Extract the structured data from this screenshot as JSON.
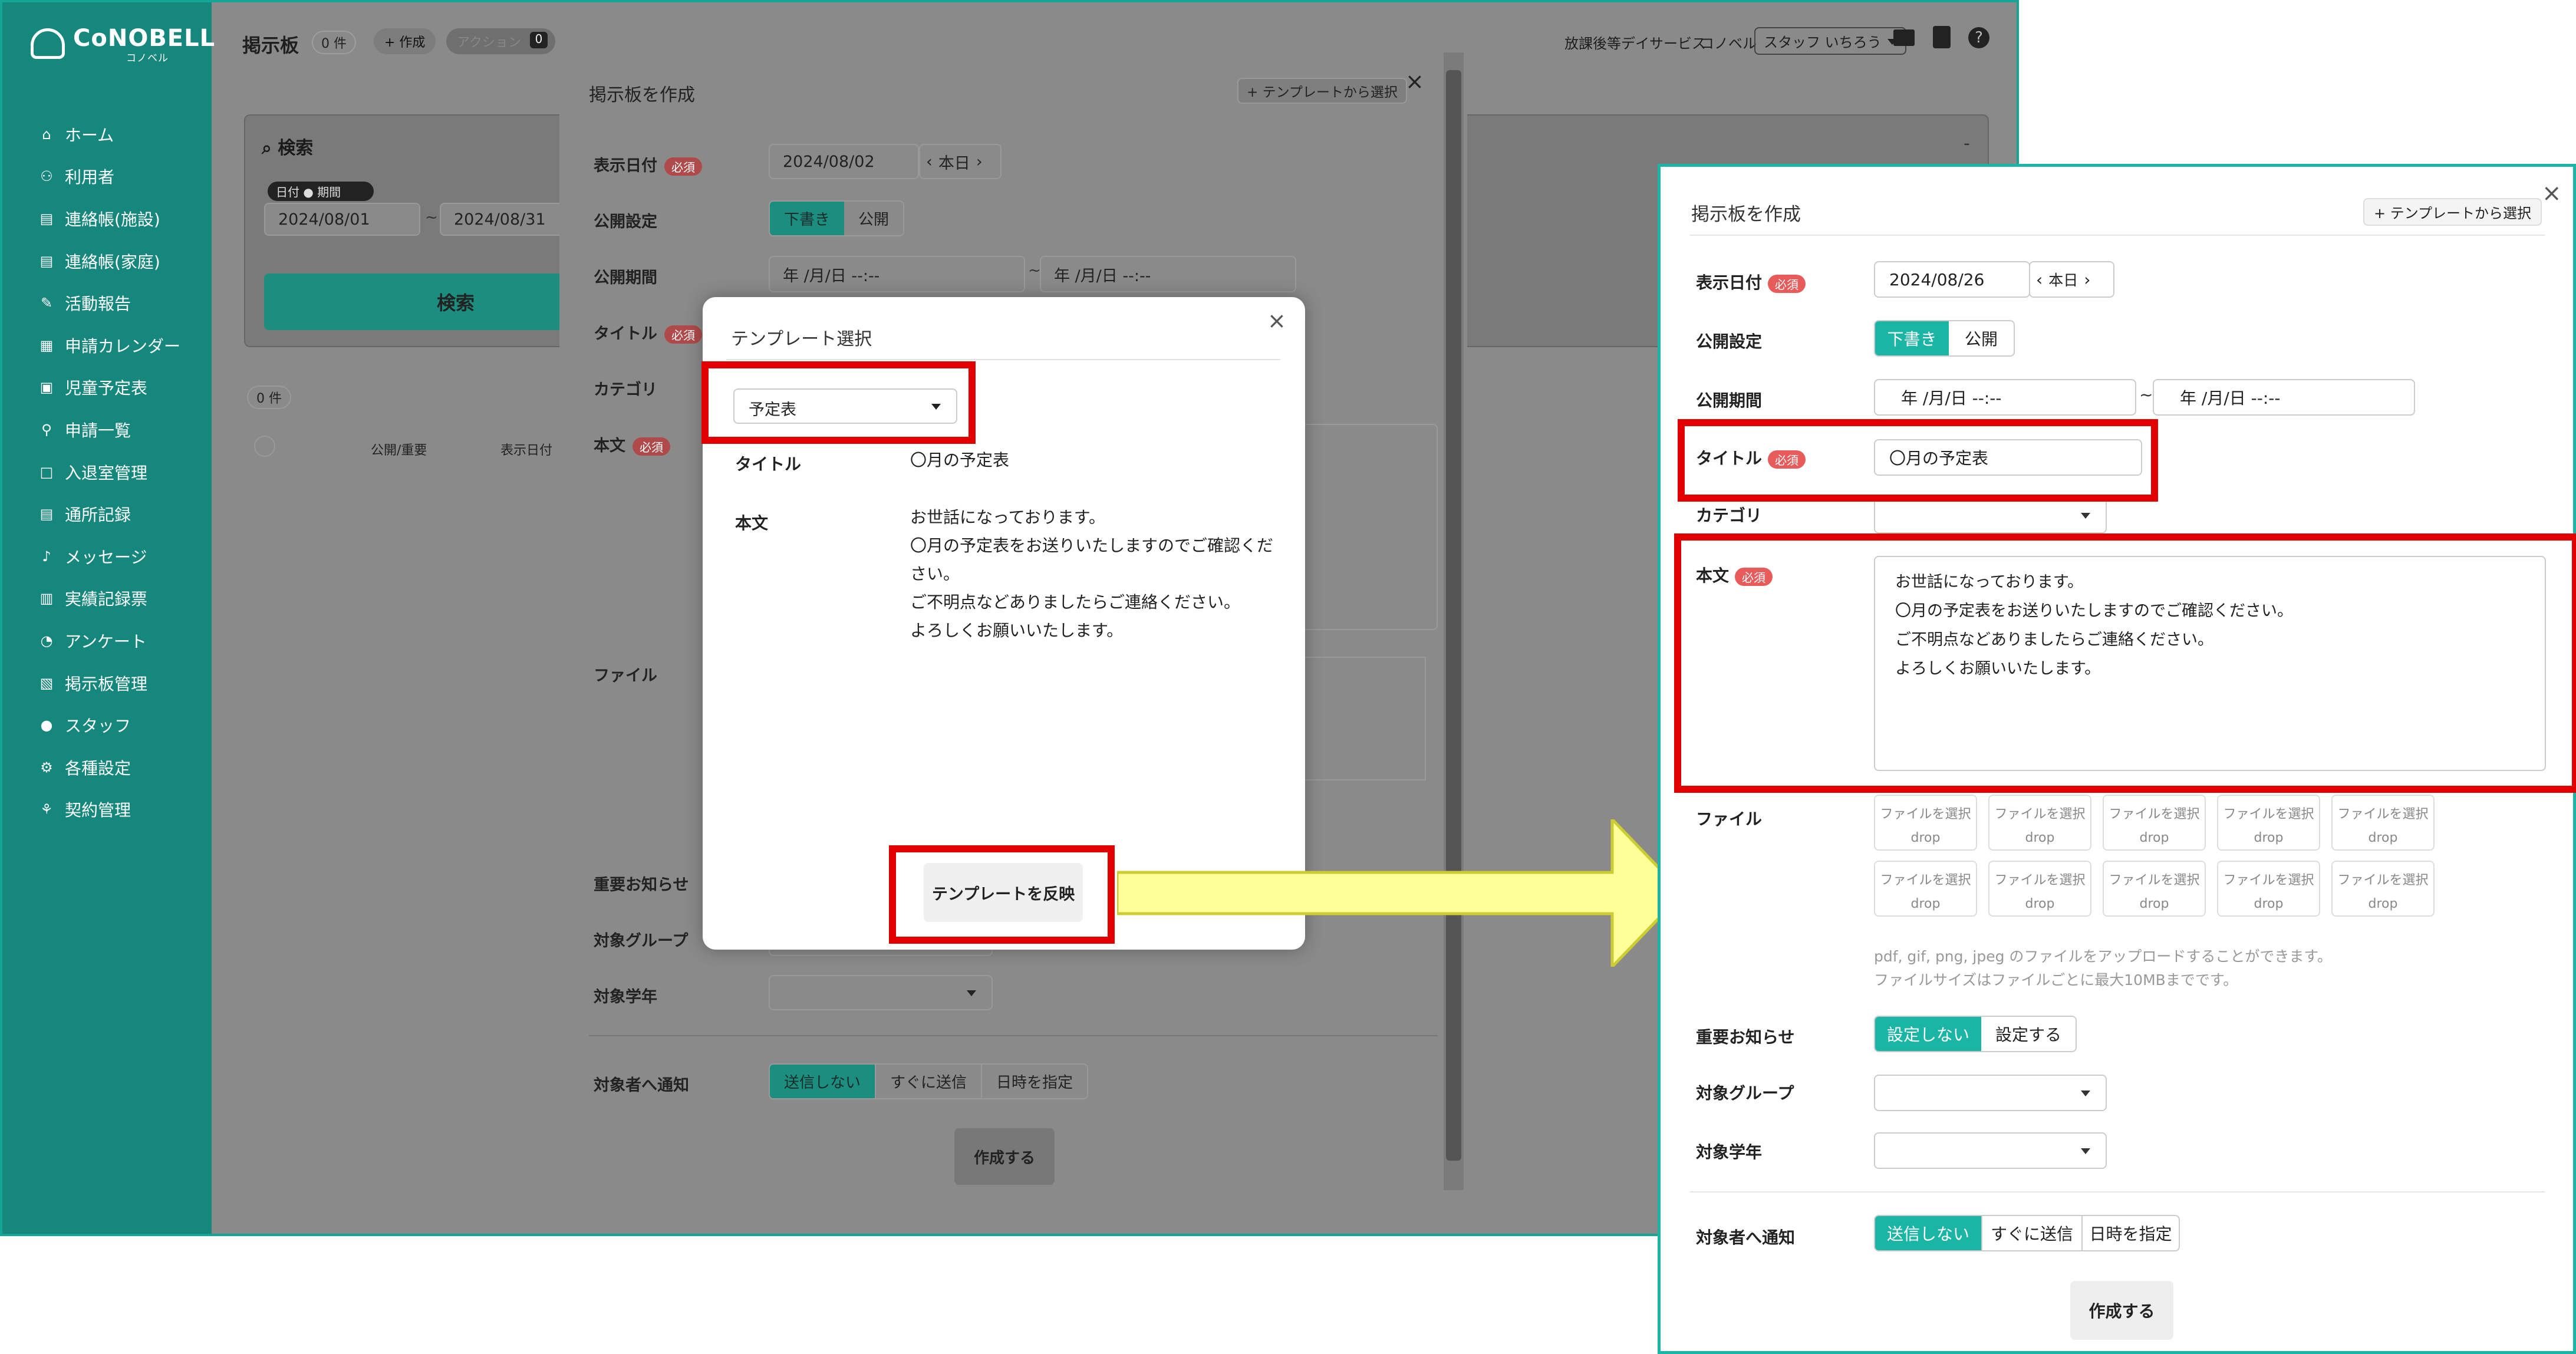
{
  "brand": {
    "name": "CoNOBELL",
    "sub": "コノベル"
  },
  "sidebar": {
    "items": [
      {
        "label": "ホーム",
        "icon": "home-icon"
      },
      {
        "label": "利用者",
        "icon": "users-icon"
      },
      {
        "label": "連絡帳(施設)",
        "icon": "notebook-icon"
      },
      {
        "label": "連絡帳(家庭)",
        "icon": "notebook-icon"
      },
      {
        "label": "活動報告",
        "icon": "edit-icon"
      },
      {
        "label": "申請カレンダー",
        "icon": "calendar-icon"
      },
      {
        "label": "児童予定表",
        "icon": "bus-icon"
      },
      {
        "label": "申請一覧",
        "icon": "filter-icon"
      },
      {
        "label": "入退室管理",
        "icon": "door-icon"
      },
      {
        "label": "通所記録",
        "icon": "book-icon"
      },
      {
        "label": "メッセージ",
        "icon": "bell-icon"
      },
      {
        "label": "実績記録票",
        "icon": "table-icon"
      },
      {
        "label": "アンケート",
        "icon": "chart-icon"
      },
      {
        "label": "掲示板管理",
        "icon": "board-icon"
      },
      {
        "label": "スタッフ",
        "icon": "person-icon"
      },
      {
        "label": "各種設定",
        "icon": "gear-icon"
      },
      {
        "label": "契約管理",
        "icon": "contract-icon"
      }
    ]
  },
  "topbar": {
    "title": "掲示板",
    "count": "0 件",
    "create": "+ 作成",
    "action": "アクション",
    "action_count": "0",
    "service": "放課後等デイサービス",
    "org": "コノベル",
    "user": "スタッフ いちろう"
  },
  "search": {
    "title": "検索",
    "toggle_left": "日付",
    "toggle_right": "期間",
    "date_from": "2024/08/01",
    "date_to": "2024/08/31",
    "button": "検索",
    "result_count": "0 件",
    "col_public": "公開/重要",
    "col_date": "表示日付"
  },
  "bg_modal": {
    "title": "掲示板を作成",
    "template_button": "+ テンプレートから選択",
    "display_date_label": "表示日付",
    "required": "必須",
    "display_date": "2024/08/02",
    "today": "本日",
    "publish_label": "公開設定",
    "draft": "下書き",
    "public": "公開",
    "period_label": "公開期間",
    "period_placeholder": "年 /月/日 --:--",
    "title_label": "タイトル",
    "category_label": "カテゴリ",
    "body_label": "本文",
    "file_label": "ファイル",
    "important_label": "重要お知らせ",
    "group_label": "対象グループ",
    "grade_label": "対象学年",
    "notify_label": "対象者へ通知",
    "notify_options": [
      "送信しない",
      "すぐに送信",
      "日時を指定"
    ],
    "submit": "作成する"
  },
  "template_modal": {
    "title": "テンプレート選択",
    "selected": "予定表",
    "title_label": "タイトル",
    "title_value": "〇月の予定表",
    "body_label": "本文",
    "body_value": "お世話になっております。\n〇月の予定表をお送りいたしますのでご確認ください。\nご不明点などありましたらご連絡ください。\nよろしくお願いいたします。",
    "apply_button": "テンプレートを反映"
  },
  "right_form": {
    "title": "掲示板を作成",
    "template_button": "+ テンプレートから選択",
    "display_date_label": "表示日付",
    "required": "必須",
    "display_date": "2024/08/26",
    "today": "本日",
    "publish_label": "公開設定",
    "draft": "下書き",
    "public": "公開",
    "period_label": "公開期間",
    "period_placeholder": "年 /月/日 --:--",
    "title_label": "タイトル",
    "title_value": "〇月の予定表",
    "category_label": "カテゴリ",
    "body_label": "本文",
    "body_value": "お世話になっております。\n〇月の予定表をお送りいたしますのでご確認ください。\nご不明点などありましたらご連絡ください。\nよろしくお願いいたします。",
    "file_label": "ファイル",
    "file_select": "ファイルを選択",
    "file_drop": "drop",
    "file_note1": "pdf, gif, png, jpeg のファイルをアップロードすることができます。",
    "file_note2": "ファイルサイズはファイルごとに最大10MBまでです。",
    "important_label": "重要お知らせ",
    "important_options": [
      "設定しない",
      "設定する"
    ],
    "group_label": "対象グループ",
    "grade_label": "対象学年",
    "notify_label": "対象者へ通知",
    "notify_options": [
      "送信しない",
      "すぐに送信",
      "日時を指定"
    ],
    "submit": "作成する"
  },
  "colors": {
    "teal": "#1ab5a4",
    "highlight": "#e10000",
    "arrow": "#ffff99"
  }
}
